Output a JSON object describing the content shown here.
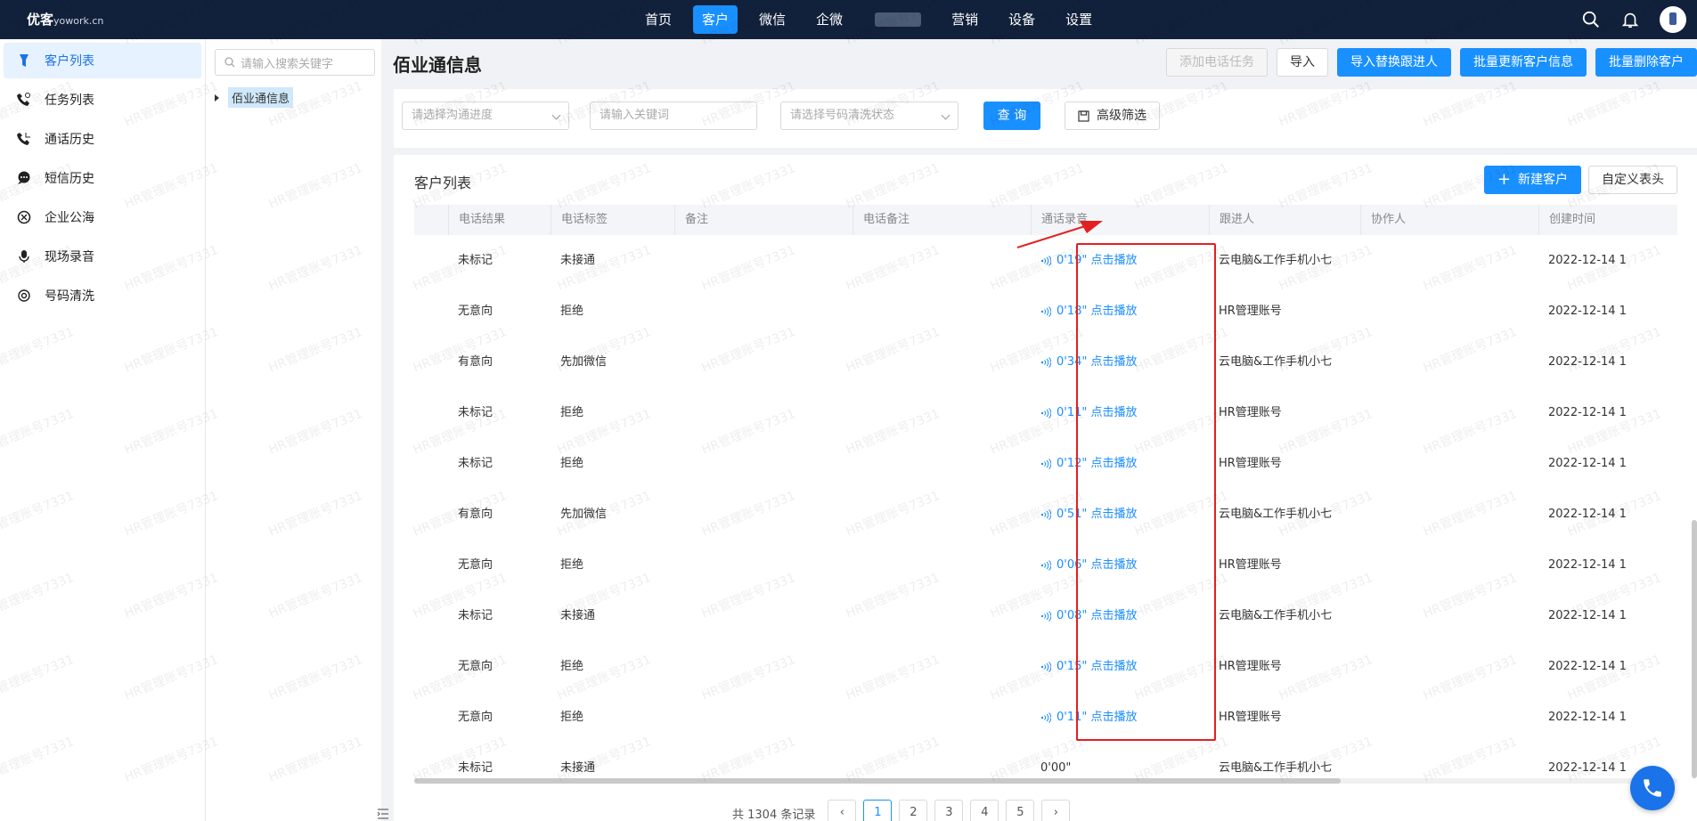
{
  "topbar": {
    "logo": "优客",
    "logo_sub": "yowork.cn",
    "nav": [
      "首页",
      "客户",
      "微信",
      "企微",
      "营销",
      "设备",
      "设置"
    ],
    "active_nav": "客户"
  },
  "sidebar": {
    "items": [
      {
        "label": "客户列表",
        "icon": "customer-list-icon",
        "active": true
      },
      {
        "label": "任务列表",
        "icon": "phone-task-icon"
      },
      {
        "label": "通话历史",
        "icon": "phone-history-icon"
      },
      {
        "label": "短信历史",
        "icon": "message-icon"
      },
      {
        "label": "企业公海",
        "icon": "sea-icon"
      },
      {
        "label": "现场录音",
        "icon": "microphone-icon"
      },
      {
        "label": "号码清洗",
        "icon": "clean-icon"
      }
    ]
  },
  "tree": {
    "search_placeholder": "请输入搜索关键字",
    "node_label": "佰业通信息"
  },
  "main": {
    "title": "佰业通信息",
    "header_buttons": {
      "add_call_task": "添加电话任务",
      "import": "导入",
      "import_replace": "导入替换跟进人",
      "bulk_update": "批量更新客户信息",
      "bulk_delete": "批量删除客户"
    },
    "filters": {
      "progress_placeholder": "请选择沟通进度",
      "keyword_placeholder": "请输入关键词",
      "clean_status_placeholder": "请选择号码清洗状态",
      "query": "查 询",
      "advanced": "高级筛选"
    },
    "list": {
      "title": "客户列表",
      "new_customer": "新建客户",
      "custom_header": "自定义表头"
    },
    "columns": [
      "电话结果",
      "电话标签",
      "备注",
      "电话备注",
      "通话录音",
      "跟进人",
      "协作人",
      "创建时间"
    ],
    "rows": [
      {
        "result": "未标记",
        "tag": "未接通",
        "recording": "0'19\" 点击播放",
        "follower": "云电脑&工作手机小七",
        "created": "2022-12-14 1"
      },
      {
        "result": "无意向",
        "tag": "拒绝",
        "recording": "0'18\" 点击播放",
        "follower": "HR管理账号",
        "created": "2022-12-14 1"
      },
      {
        "result": "有意向",
        "tag": "先加微信",
        "recording": "0'34\" 点击播放",
        "follower": "云电脑&工作手机小七",
        "created": "2022-12-14 1"
      },
      {
        "result": "未标记",
        "tag": "拒绝",
        "recording": "0'11\" 点击播放",
        "follower": "HR管理账号",
        "created": "2022-12-14 1"
      },
      {
        "result": "未标记",
        "tag": "拒绝",
        "recording": "0'12\" 点击播放",
        "follower": "HR管理账号",
        "created": "2022-12-14 1"
      },
      {
        "result": "有意向",
        "tag": "先加微信",
        "recording": "0'51\" 点击播放",
        "follower": "云电脑&工作手机小七",
        "created": "2022-12-14 1"
      },
      {
        "result": "无意向",
        "tag": "拒绝",
        "recording": "0'06\" 点击播放",
        "follower": "HR管理账号",
        "created": "2022-12-14 1"
      },
      {
        "result": "未标记",
        "tag": "未接通",
        "recording": "0'08\" 点击播放",
        "follower": "云电脑&工作手机小七",
        "created": "2022-12-14 1"
      },
      {
        "result": "无意向",
        "tag": "拒绝",
        "recording": "0'15\" 点击播放",
        "follower": "HR管理账号",
        "created": "2022-12-14 1"
      },
      {
        "result": "无意向",
        "tag": "拒绝",
        "recording": "0'11\" 点击播放",
        "follower": "HR管理账号",
        "created": "2022-12-14 1"
      },
      {
        "result": "未标记",
        "tag": "未接通",
        "recording": "0'00\"",
        "follower": "云电脑&工作手机小七",
        "created": "2022-12-14 1"
      }
    ],
    "pager": {
      "summary": "共 1304 条记录",
      "pages": [
        "1",
        "2",
        "3",
        "4",
        "5"
      ]
    }
  },
  "watermark": "HR管理账号7331",
  "colors": {
    "primary": "#1990ff",
    "topbar": "#12213b",
    "highlight": "#e32020",
    "link": "#1a8cff"
  }
}
